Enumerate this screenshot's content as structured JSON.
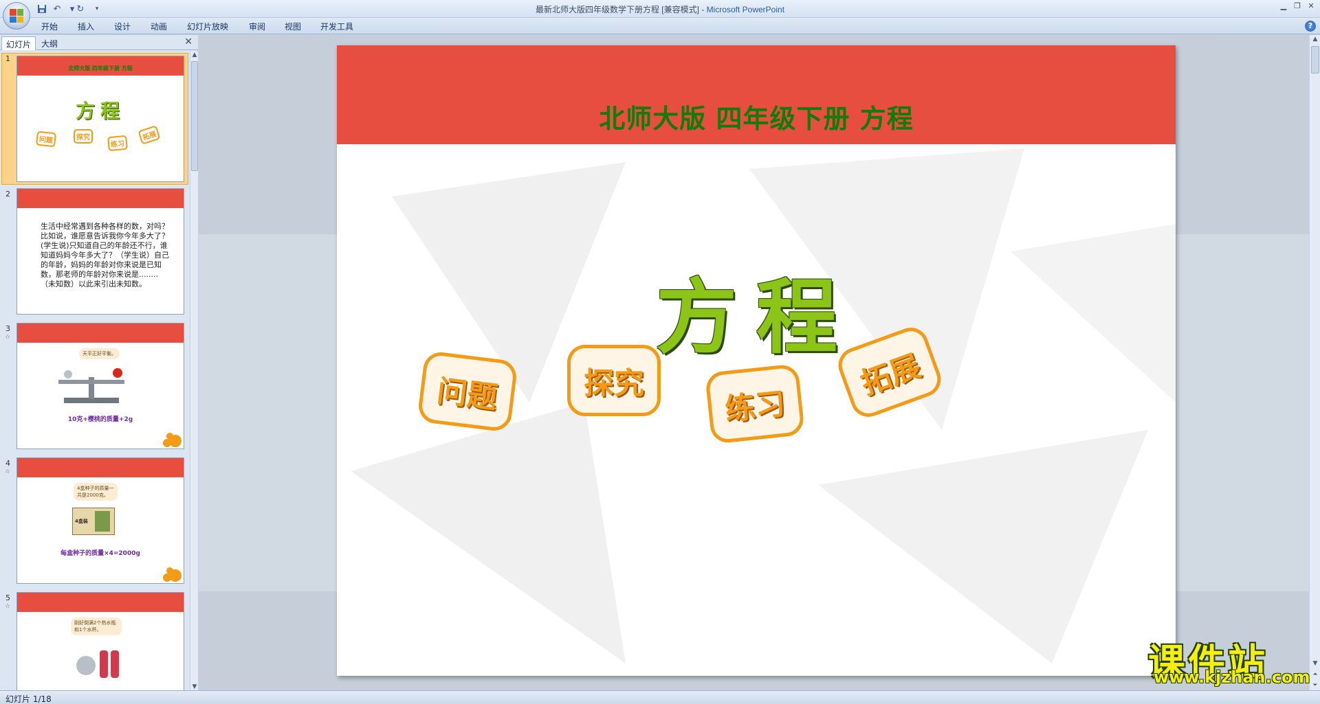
{
  "window": {
    "doc_name": "最新北师大版四年级数学下册方程 [兼容模式]",
    "separator": " - ",
    "app_name": "Microsoft PowerPoint"
  },
  "ribbon": {
    "tabs": [
      "开始",
      "插入",
      "设计",
      "动画",
      "幻灯片放映",
      "审阅",
      "视图",
      "开发工具"
    ],
    "help_icon": "help-icon"
  },
  "left_pane": {
    "tabs": [
      "幻灯片",
      "大纲"
    ],
    "thumbnails": [
      {
        "number": "1",
        "header": "北师大版  四年级下册    方程",
        "big": "方程",
        "pills": [
          "问题",
          "探究",
          "练习",
          "拓展"
        ]
      },
      {
        "number": "2",
        "text": "生活中经常遇到各种各样的数，对吗？比如说，谁愿意告诉我你今年多大了？(学生说)只知道自己的年龄还不行，谁知道妈妈今年多大了？（学生说）自己的年龄，妈妈的年龄对你来说是已知数，那老师的年龄对你来说是........（未知数）以此来引出未知数。"
      },
      {
        "number": "3",
        "bubble": "天平正好平衡。",
        "caption": "10克+樱桃的质量+2g"
      },
      {
        "number": "4",
        "bubble": "4盒种子的质量一共是2000克。",
        "box_label": "4盒装",
        "caption": "每盒种子的质量×4=2000g"
      },
      {
        "number": "5",
        "bubble": "刚好倒满2个热水瓶和1个水杯。"
      }
    ]
  },
  "slide": {
    "title": "北师大版  四年级下册    方程",
    "big_title": "方程",
    "buttons": [
      "问题",
      "探究",
      "练习",
      "拓展"
    ]
  },
  "status": {
    "text": "幻灯片 1/18"
  },
  "watermark": {
    "cn": "课件站",
    "url": "www.kjzhan.com"
  },
  "colors": {
    "header_red": "#e84e3f",
    "title_green": "#0f7c0b",
    "big_title_green": "#8cc417",
    "pill_orange": "#f39a16",
    "selection": "#fbd48a"
  }
}
